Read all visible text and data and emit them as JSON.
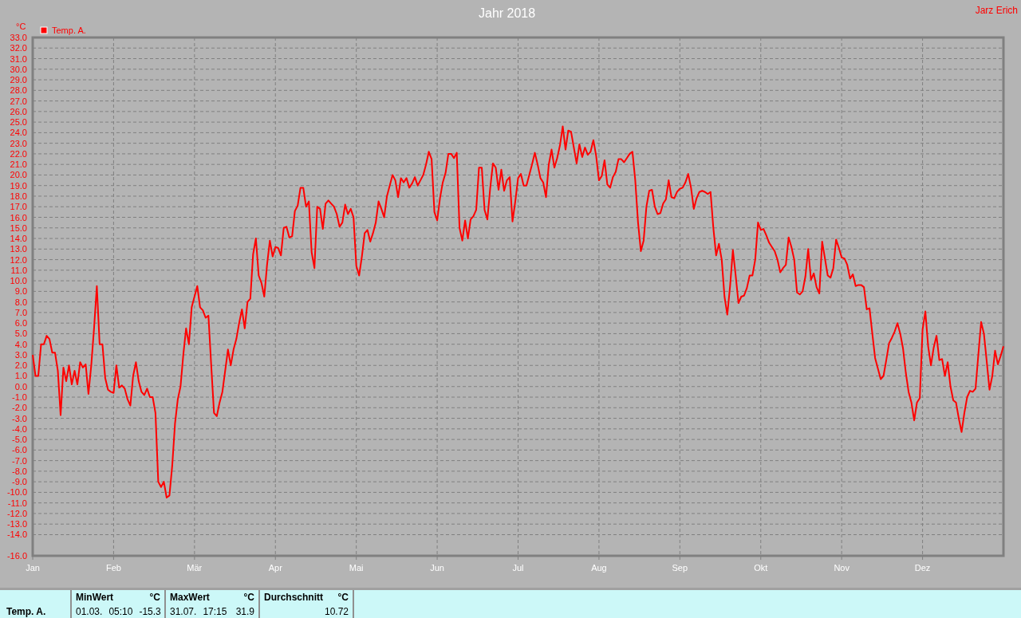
{
  "title": "Jahr 2018",
  "author": "Jarz Erich",
  "chart": {
    "unit": "°C",
    "months": [
      "Jan",
      "Feb",
      "Mär",
      "Apr",
      "Mai",
      "Jun",
      "Jul",
      "Aug",
      "Sep",
      "Okt",
      "Nov",
      "Dez"
    ],
    "chart_data": {
      "type": "line",
      "grid": true,
      "ylim": [
        -16,
        33
      ],
      "yticks": [
        {
          "value": 33,
          "label": "33.0"
        },
        {
          "value": 32,
          "label": "32.0"
        },
        {
          "value": 31,
          "label": "31.0"
        },
        {
          "value": 30,
          "label": "30.0"
        },
        {
          "value": 29,
          "label": "29.0"
        },
        {
          "value": 28,
          "label": "28.0"
        },
        {
          "value": 27,
          "label": "27.0"
        },
        {
          "value": 26,
          "label": "26.0"
        },
        {
          "value": 25,
          "label": "25.0"
        },
        {
          "value": 24,
          "label": "24.0"
        },
        {
          "value": 23,
          "label": "23.0"
        },
        {
          "value": 22,
          "label": "22.0"
        },
        {
          "value": 21,
          "label": "21.0"
        },
        {
          "value": 20,
          "label": "20.0"
        },
        {
          "value": 19,
          "label": "19.0"
        },
        {
          "value": 18,
          "label": "18.0"
        },
        {
          "value": 17,
          "label": "17.0"
        },
        {
          "value": 16,
          "label": "16.0"
        },
        {
          "value": 15,
          "label": "15.0"
        },
        {
          "value": 14,
          "label": "14.0"
        },
        {
          "value": 13,
          "label": "13.0"
        },
        {
          "value": 12,
          "label": "12.0"
        },
        {
          "value": 11,
          "label": "11.0"
        },
        {
          "value": 10,
          "label": "10.0"
        },
        {
          "value": 9,
          "label": "9.0"
        },
        {
          "value": 8,
          "label": "8.0"
        },
        {
          "value": 7,
          "label": "7.0"
        },
        {
          "value": 6,
          "label": "6.0"
        },
        {
          "value": 5,
          "label": "5.0"
        },
        {
          "value": 4,
          "label": "4.0"
        },
        {
          "value": 3,
          "label": "3.0"
        },
        {
          "value": 2,
          "label": "2.0"
        },
        {
          "value": 1,
          "label": "1.0"
        },
        {
          "value": 0,
          "label": "0.0"
        },
        {
          "value": -1,
          "label": "-1.0"
        },
        {
          "value": -2,
          "label": "-2.0"
        },
        {
          "value": -3,
          "label": "-3.0"
        },
        {
          "value": -4,
          "label": "-4.0"
        },
        {
          "value": -5,
          "label": "-5.0"
        },
        {
          "value": -6,
          "label": "-6.0"
        },
        {
          "value": -7,
          "label": "-7.0"
        },
        {
          "value": -8,
          "label": "-8.0"
        },
        {
          "value": -9,
          "label": "-9.0"
        },
        {
          "value": -10,
          "label": "-10.0"
        },
        {
          "value": -11,
          "label": "-11.0"
        },
        {
          "value": -12,
          "label": "-12.0"
        },
        {
          "value": -13,
          "label": "-13.0"
        },
        {
          "value": -14,
          "label": "-14.0"
        },
        {
          "value": -16,
          "label": "-16.0"
        }
      ],
      "series": [
        {
          "name": "Temp. A.",
          "color": "#ff0000",
          "values": [
            3.0,
            1.0,
            1.0,
            4.0,
            4.0,
            4.8,
            4.5,
            3.2,
            3.2,
            1.5,
            -2.7,
            1.8,
            0.5,
            2.0,
            0.2,
            1.5,
            0.2,
            2.3,
            1.8,
            2.1,
            -0.7,
            2.0,
            5.5,
            9.5,
            4.0,
            4.0,
            0.8,
            -0.3,
            -0.5,
            -0.6,
            2.0,
            -0.1,
            0.1,
            -0.2,
            -1.2,
            -1.8,
            1.0,
            2.3,
            0.5,
            -0.5,
            -0.8,
            -0.2,
            -1.0,
            -1.0,
            -2.5,
            -9.0,
            -9.5,
            -9.0,
            -10.5,
            -10.3,
            -7.5,
            -3.5,
            -1.2,
            0.0,
            3.0,
            5.5,
            4.0,
            7.5,
            8.5,
            9.5,
            7.5,
            7.2,
            6.5,
            6.7,
            2.0,
            -2.5,
            -2.8,
            -1.5,
            -0.5,
            1.5,
            3.5,
            2.0,
            3.5,
            4.5,
            6.0,
            7.3,
            5.5,
            8.0,
            8.3,
            12.5,
            14.0,
            10.5,
            9.8,
            8.5,
            11.5,
            13.8,
            12.3,
            13.2,
            13.1,
            12.4,
            15.0,
            15.1,
            14.1,
            14.2,
            16.6,
            17.1,
            18.8,
            18.8,
            17.0,
            17.5,
            12.7,
            11.2,
            17.0,
            16.8,
            14.9,
            17.3,
            17.6,
            17.3,
            17.0,
            16.3,
            15.1,
            15.5,
            17.2,
            16.3,
            16.8,
            16.0,
            11.4,
            10.5,
            12.3,
            14.5,
            14.8,
            13.7,
            14.5,
            15.5,
            17.5,
            16.8,
            16.0,
            18.0,
            19.0,
            20.0,
            19.5,
            17.9,
            19.7,
            19.3,
            19.7,
            18.8,
            19.2,
            19.8,
            19.0,
            19.5,
            20.0,
            21.0,
            22.2,
            21.5,
            16.5,
            15.7,
            17.8,
            19.3,
            20.2,
            22.0,
            22.0,
            21.6,
            22.1,
            15.0,
            13.8,
            15.7,
            14.0,
            15.8,
            16.1,
            16.7,
            20.7,
            20.7,
            16.7,
            15.8,
            18.7,
            21.1,
            20.7,
            18.6,
            20.5,
            18.5,
            19.5,
            19.8,
            15.6,
            17.5,
            19.7,
            20.1,
            19.0,
            19.0,
            20.0,
            21.0,
            22.1,
            21.0,
            19.7,
            19.3,
            17.9,
            21.0,
            22.4,
            20.7,
            21.6,
            22.8,
            24.6,
            22.4,
            24.2,
            24.1,
            22.6,
            21.1,
            22.9,
            21.7,
            22.6,
            21.9,
            22.2,
            23.3,
            21.8,
            19.5,
            19.9,
            21.4,
            19.1,
            18.8,
            19.8,
            20.3,
            21.5,
            21.5,
            21.2,
            21.6,
            22.0,
            22.2,
            19.5,
            15.5,
            12.8,
            13.8,
            17.0,
            18.5,
            18.6,
            17.0,
            16.3,
            16.4,
            17.3,
            17.7,
            19.5,
            17.9,
            17.8,
            18.4,
            18.7,
            18.8,
            19.3,
            20.1,
            18.8,
            16.8,
            17.8,
            18.4,
            18.5,
            18.4,
            18.2,
            18.4,
            15.0,
            12.4,
            13.5,
            12.0,
            8.5,
            6.8,
            9.5,
            12.9,
            10.5,
            7.9,
            8.5,
            8.6,
            9.3,
            10.5,
            10.5,
            12.0,
            15.5,
            14.8,
            14.9,
            14.3,
            13.6,
            13.2,
            12.8,
            12.0,
            10.8,
            11.2,
            11.5,
            14.1,
            13.2,
            12.0,
            8.9,
            8.7,
            9.0,
            10.4,
            13.0,
            10.1,
            10.7,
            9.4,
            8.8,
            13.7,
            12.1,
            10.5,
            10.3,
            11.2,
            13.9,
            13.1,
            12.2,
            12.1,
            11.5,
            10.2,
            10.6,
            9.5,
            9.6,
            9.6,
            9.4,
            7.3,
            7.4,
            5.0,
            2.7,
            1.7,
            0.7,
            1.0,
            2.5,
            4.1,
            4.6,
            5.2,
            6.0,
            5.0,
            3.6,
            1.3,
            -0.5,
            -1.5,
            -3.2,
            -1.5,
            -1.1,
            5.4,
            7.1,
            3.8,
            2.0,
            3.7,
            4.8,
            2.5,
            2.6,
            1.0,
            2.3,
            0.0,
            -1.3,
            -1.5,
            -3.0,
            -4.3,
            -2.5,
            -1.0,
            -0.4,
            -0.5,
            -0.2,
            3.0,
            6.1,
            5.0,
            2.4,
            -0.3,
            1.0,
            3.4,
            2.1,
            2.9,
            3.8
          ]
        }
      ]
    }
  },
  "stats": {
    "row_label": "Temp. A.",
    "columns": [
      {
        "header": "MinWert",
        "unit": "°C",
        "date": "01.03.",
        "time": "05:10",
        "value": "-15.3"
      },
      {
        "header": "MaxWert",
        "unit": "°C",
        "date": "31.07.",
        "time": "17:15",
        "value": "31.9"
      },
      {
        "header": "Durchschnitt",
        "unit": "°C",
        "value": "10.72"
      }
    ]
  }
}
